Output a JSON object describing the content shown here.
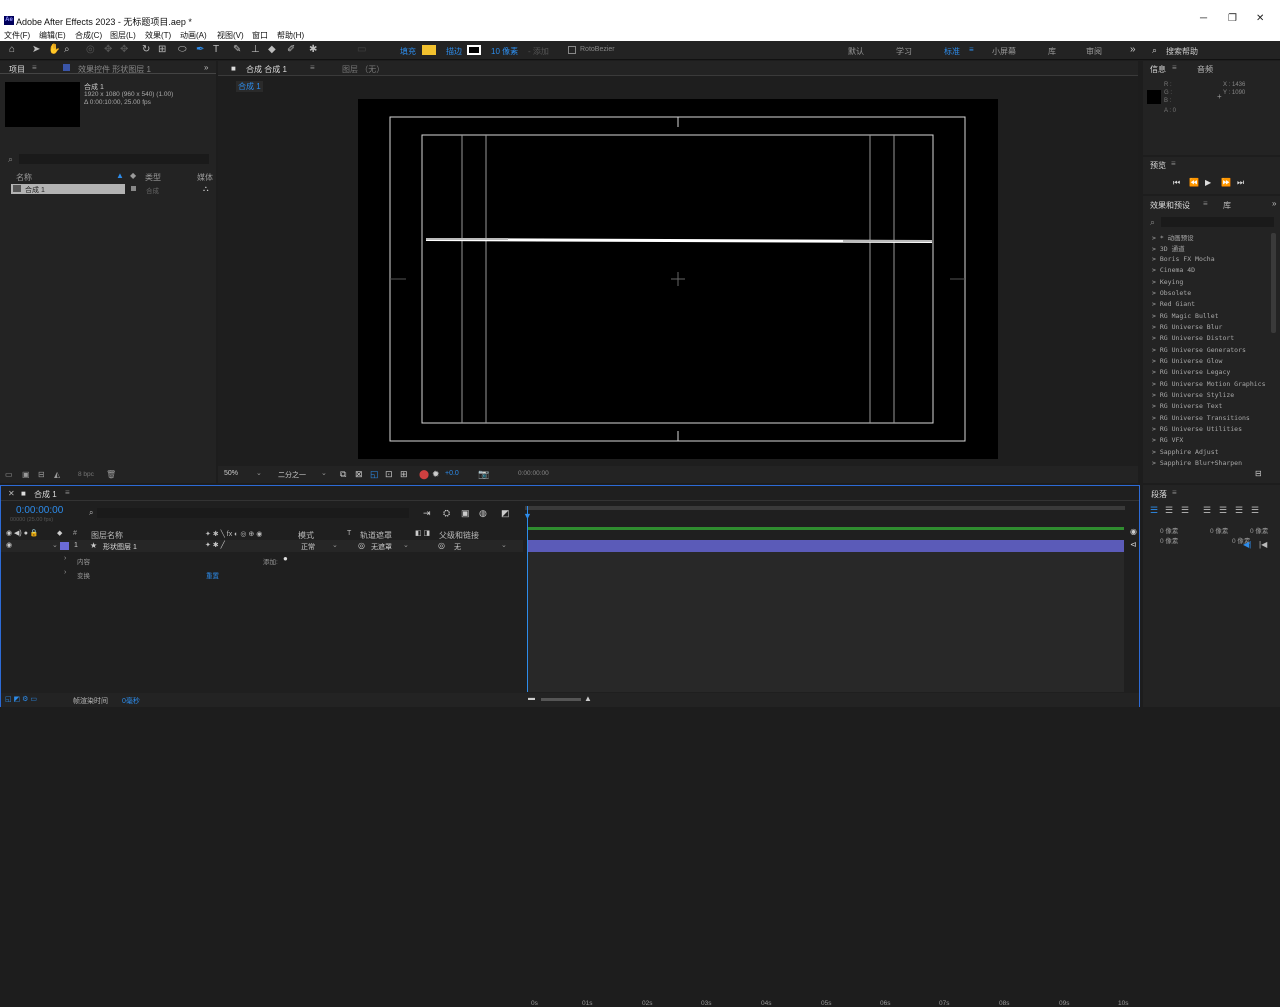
{
  "window": {
    "title": "Adobe After Effects 2023 - 无标题项目.aep *",
    "logo": "Ae"
  },
  "menu": [
    "文件(F)",
    "编辑(E)",
    "合成(C)",
    "图层(L)",
    "效果(T)",
    "动画(A)",
    "视图(V)",
    "窗口",
    "帮助(H)"
  ],
  "toolbar": {
    "fill_label": "填充",
    "stroke_label": "描边",
    "stroke_width": "10 像素",
    "stroke_dash": "- 添加",
    "rotobezier": "RotoBezier",
    "fill_color": "#f2c12e",
    "workspaces": [
      "默认",
      "学习",
      "标准",
      "小屏幕",
      "库",
      "审阅"
    ],
    "active_workspace": "标准",
    "search_placeholder": "搜索帮助"
  },
  "project_panel": {
    "tab": "项目",
    "effects_tab": "效果控件 形状图层 1",
    "comp_name": "合成 1",
    "comp_info1": "1920 x 1080  (960 x 540) (1.00)",
    "comp_info2": "Δ 0:00:10:00, 25.00 fps",
    "columns": [
      "名称",
      "类型",
      "媒体"
    ],
    "items": [
      {
        "name": "合成 1",
        "type": "合成"
      }
    ],
    "bpc": "8 bpc"
  },
  "comp_panel": {
    "tab": "合成 合成 1",
    "layer_tab": "图层 （无）",
    "breadcrumb": "合成 1",
    "zoom": "50%",
    "resolution": "二分之一",
    "exposure": "+0.0",
    "timecode": "0:00:00:00"
  },
  "info_panel": {
    "tab": "信息",
    "audio_tab": "音频",
    "rgba": [
      "R :",
      "G :",
      "B :",
      "A : 0"
    ],
    "x": "X : 1436",
    "y": "Y : 1090"
  },
  "preview_panel": {
    "tab": "预览"
  },
  "effects_panel": {
    "tab": "效果和预设",
    "lib_tab": "库",
    "items": [
      "> * 动画预设",
      "> 3D 通道",
      "> Boris FX Mocha",
      "> Cinema 4D",
      "> Keying",
      "> Obsolete",
      "> Red Giant",
      "> RG Magic Bullet",
      "> RG Universe Blur",
      "> RG Universe Distort",
      "> RG Universe Generators",
      "> RG Universe Glow",
      "> RG Universe Legacy",
      "> RG Universe Motion Graphics",
      "> RG Universe Stylize",
      "> RG Universe Text",
      "> RG Universe Transitions",
      "> RG Universe Utilities",
      "> RG VFX",
      "> Sapphire Adjust",
      "> Sapphire Blur+Sharpen"
    ]
  },
  "paragraph_panel": {
    "tab": "段落",
    "values": [
      "0 像素",
      "0 像素",
      "0 像素",
      "0 像素",
      "0 像素"
    ]
  },
  "timeline": {
    "tab": "合成 1",
    "timecode": "0:00:00:00",
    "frames": "00000 (25.00 fps)",
    "search_placeholder": "",
    "columns": [
      "#",
      "图层名称",
      "模式",
      "T",
      "轨道遮罩",
      "父级和链接"
    ],
    "layer": {
      "index": "1",
      "name": "形状图层 1",
      "mode": "正常",
      "matte": "无遮罩",
      "parent": "无",
      "color": "#6b6bd6"
    },
    "sub": [
      {
        "name": "内容",
        "extra": "添加:"
      },
      {
        "name": "变换",
        "extra": "重置"
      }
    ],
    "ticks": [
      "0s",
      "01s",
      "02s",
      "03s",
      "04s",
      "05s",
      "06s",
      "07s",
      "08s",
      "09s",
      "10s"
    ],
    "render_label": "帧渲染时间",
    "render_value": "0毫秒"
  }
}
